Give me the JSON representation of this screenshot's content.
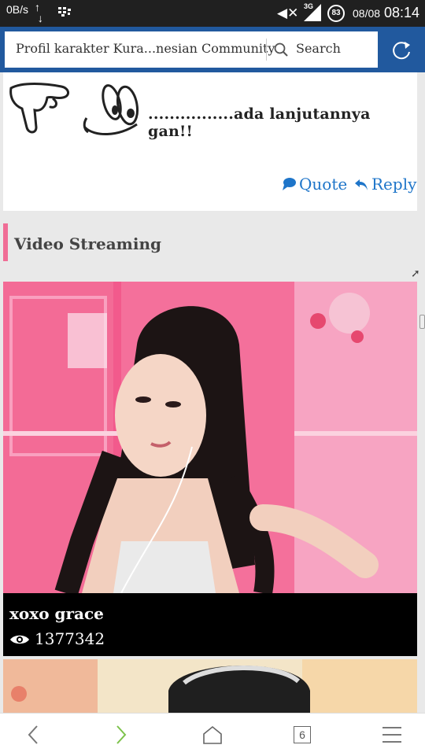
{
  "status_bar": {
    "net_speed": "0B/s",
    "network": "3G",
    "battery": "83",
    "date": "08/08",
    "time": "08:14"
  },
  "address_bar": {
    "page_title": "Profil karakter Kura...nesian Community",
    "search_label": "Search"
  },
  "post": {
    "text": "................ada lanjutannya gan!!",
    "quote_label": "Quote",
    "reply_label": "Reply"
  },
  "section": {
    "title": "Video Streaming"
  },
  "video_card": {
    "name": "xoxo grace",
    "views": "1377342"
  },
  "bottom_nav": {
    "tabs_count": "6"
  },
  "colors": {
    "toolbar": "#21599e",
    "accent_link": "#1e75c9",
    "section_marker": "#f06d96",
    "forward_arrow": "#7cc24a"
  }
}
